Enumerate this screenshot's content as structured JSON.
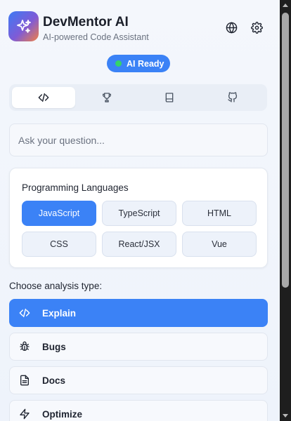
{
  "app": {
    "title": "DevMentor AI",
    "subtitle": "AI-powered Code Assistant",
    "status": "AI Ready",
    "colors": {
      "accent": "#3b82f6",
      "status_dot": "#34d36a"
    }
  },
  "header_actions": [
    {
      "icon": "globe-icon"
    },
    {
      "icon": "gear-icon"
    }
  ],
  "tabs": [
    {
      "icon": "code-icon",
      "active": true
    },
    {
      "icon": "trophy-icon",
      "active": false
    },
    {
      "icon": "book-icon",
      "active": false
    },
    {
      "icon": "github-icon",
      "active": false
    }
  ],
  "question": {
    "placeholder": "Ask your question...",
    "value": ""
  },
  "languages": {
    "title": "Programming Languages",
    "items": [
      "JavaScript",
      "TypeScript",
      "HTML",
      "CSS",
      "React/JSX",
      "Vue"
    ],
    "selected": "JavaScript"
  },
  "analysis": {
    "label": "Choose analysis type:",
    "items": [
      {
        "label": "Explain",
        "icon": "code-icon",
        "active": true
      },
      {
        "label": "Bugs",
        "icon": "bug-icon",
        "active": false
      },
      {
        "label": "Docs",
        "icon": "document-icon",
        "active": false
      },
      {
        "label": "Optimize",
        "icon": "lightning-icon",
        "active": false
      }
    ]
  }
}
